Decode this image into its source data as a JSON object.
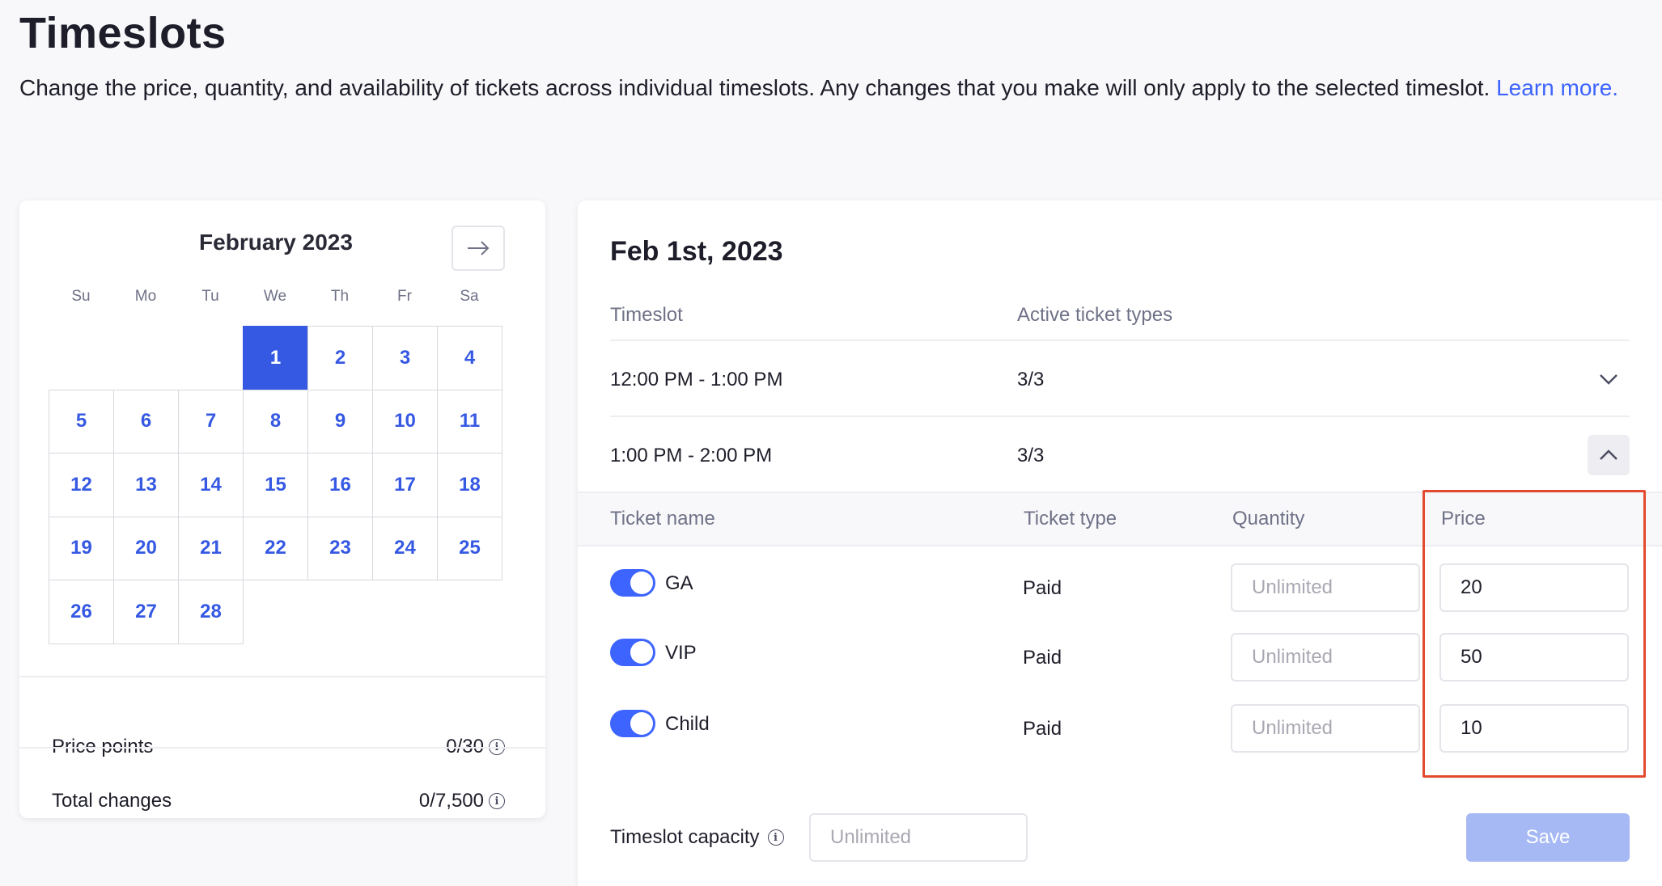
{
  "page": {
    "title": "Timeslots",
    "description": "Change the price, quantity, and availability of tickets across individual timeslots. Any changes that you make will only apply to the selected timeslot.",
    "learn_more": "Learn more."
  },
  "calendar": {
    "month_label": "February 2023",
    "weekdays": [
      "Su",
      "Mo",
      "Tu",
      "We",
      "Th",
      "Fr",
      "Sa"
    ],
    "leading_blank_days": 3,
    "days": [
      "1",
      "2",
      "3",
      "4",
      "5",
      "6",
      "7",
      "8",
      "9",
      "10",
      "11",
      "12",
      "13",
      "14",
      "15",
      "16",
      "17",
      "18",
      "19",
      "20",
      "21",
      "22",
      "23",
      "24",
      "25",
      "26",
      "27",
      "28"
    ],
    "selected_day": "1",
    "stats": {
      "price_points_label": "Price points",
      "price_points_value": "0/30",
      "total_changes_label": "Total changes",
      "total_changes_value": "0/7,500"
    }
  },
  "detail": {
    "date_title": "Feb 1st, 2023",
    "headers": {
      "timeslot": "Timeslot",
      "active_ticket_types": "Active ticket types"
    },
    "timeslots": [
      {
        "time": "12:00 PM - 1:00 PM",
        "active": "3/3",
        "expanded": false
      },
      {
        "time": "1:00 PM - 2:00 PM",
        "active": "3/3",
        "expanded": true
      }
    ],
    "ticket_headers": {
      "name": "Ticket name",
      "type": "Ticket type",
      "quantity": "Quantity",
      "price": "Price"
    },
    "tickets": [
      {
        "name": "GA",
        "type": "Paid",
        "quantity_placeholder": "Unlimited",
        "price": "20",
        "enabled": true
      },
      {
        "name": "VIP",
        "type": "Paid",
        "quantity_placeholder": "Unlimited",
        "price": "50",
        "enabled": true
      },
      {
        "name": "Child",
        "type": "Paid",
        "quantity_placeholder": "Unlimited",
        "price": "10",
        "enabled": true
      }
    ],
    "capacity_label": "Timeslot capacity",
    "capacity_placeholder": "Unlimited",
    "save_label": "Save"
  },
  "colors": {
    "accent": "#3d64ff",
    "calendar_day": "#3659e3",
    "highlight": "#e34a2f",
    "save_disabled": "#a7b9f5"
  }
}
